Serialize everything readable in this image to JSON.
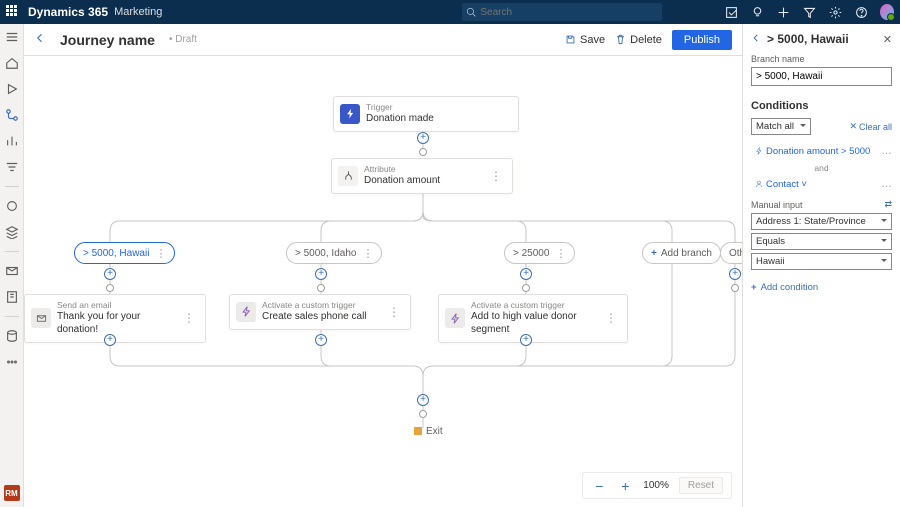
{
  "top": {
    "brand": "Dynamics 365",
    "sub": "Marketing",
    "search_placeholder": "Search"
  },
  "cmd": {
    "title": "Journey name",
    "status": "Draft",
    "save": "Save",
    "delete": "Delete",
    "publish": "Publish"
  },
  "canvas": {
    "trigger": {
      "eyebrow": "Trigger",
      "label": "Donation made"
    },
    "attribute": {
      "eyebrow": "Attribute",
      "label": "Donation amount"
    },
    "branches": {
      "b1": "> 5000, Hawaii",
      "b2": "> 5000, Idaho",
      "b3": "> 25000",
      "add": "Add branch",
      "other": "Other"
    },
    "action1": {
      "eyebrow": "Send an email",
      "label": "Thank you for your donation!"
    },
    "action2": {
      "eyebrow": "Activate a custom trigger",
      "label": "Create sales phone call"
    },
    "action3": {
      "eyebrow": "Activate a custom trigger",
      "label": "Add to high value donor segment"
    },
    "exit": "Exit"
  },
  "zoom": {
    "value": "100%",
    "reset": "Reset"
  },
  "panel": {
    "title": "> 5000, Hawaii",
    "branch_name_label": "Branch name",
    "branch_name_value": "> 5000, Hawaii",
    "conditions": "Conditions",
    "match_all": "Match all",
    "clear_all": "Clear all",
    "cond1": "Donation amount > 5000",
    "and": "and",
    "contact": "Contact",
    "manual": "Manual input",
    "field": "Address 1: State/Province",
    "op": "Equals",
    "value": "Hawaii",
    "add": "Add condition"
  },
  "rm": "RM"
}
